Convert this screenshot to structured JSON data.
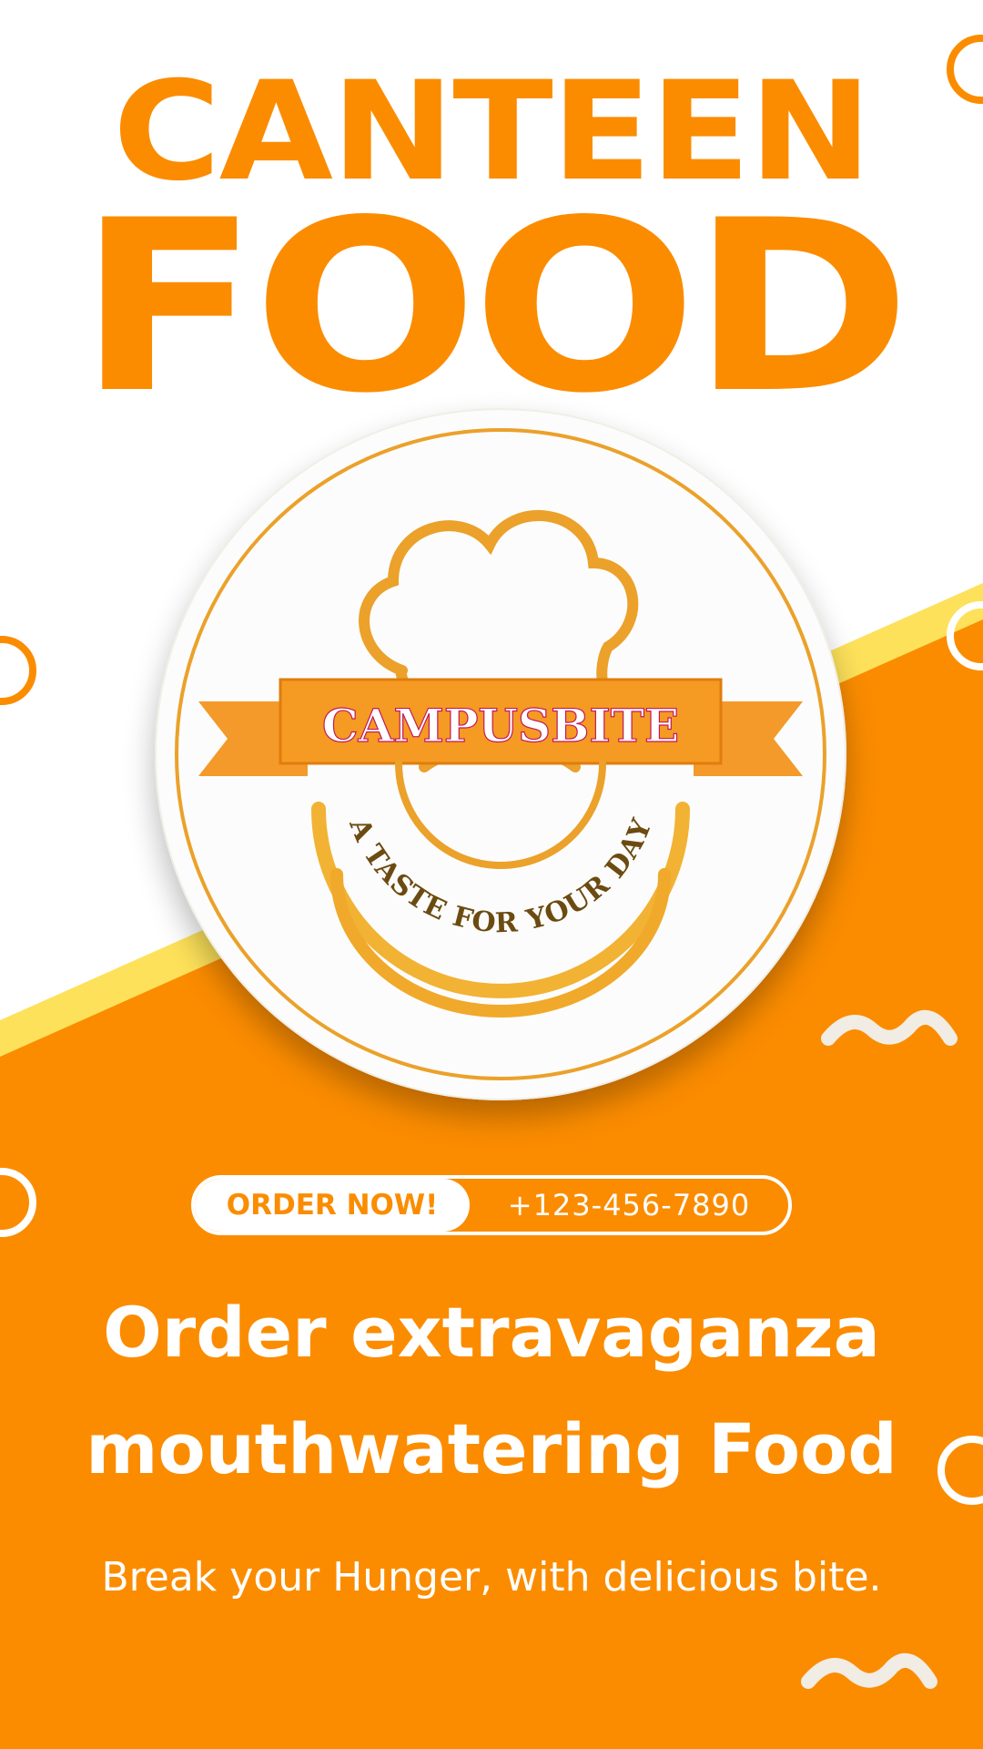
{
  "poster": {
    "title_line1": "CANTEEN",
    "title_line2": "FOOD",
    "brand_name": "CAMPUSBITE",
    "brand_tagline": "A TASTE FOR YOUR DAY",
    "cta_label": "ORDER NOW!",
    "phone": "+123-456-7890",
    "headline_line1": "Order extravaganza",
    "headline_line2": "mouthwatering Food",
    "subtext": "Break your Hunger, with delicious bite."
  },
  "colors": {
    "accent_orange": "#fb8c00",
    "stripe_yellow": "#fde15a",
    "background": "#ffffff"
  }
}
